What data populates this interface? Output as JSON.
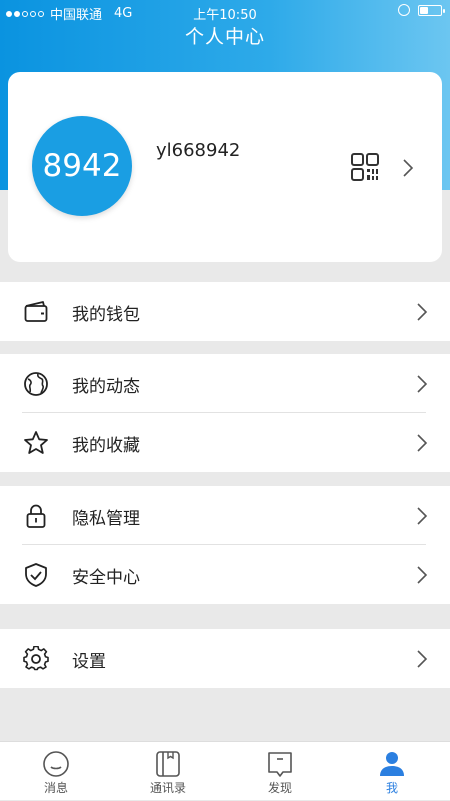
{
  "status_bar": {
    "carrier": "中国联通",
    "network": "4G",
    "time": "上午10:50"
  },
  "header": {
    "title": "个人中心"
  },
  "profile": {
    "avatar_text": "8942",
    "username": "yl668942",
    "avatar_color": "#1a9ee3"
  },
  "menu": {
    "wallet": "我的钱包",
    "moments": "我的动态",
    "favorites": "我的收藏",
    "privacy": "隐私管理",
    "security": "安全中心",
    "settings": "设置"
  },
  "tabs": [
    {
      "label": "消息",
      "icon": "message-icon"
    },
    {
      "label": "通讯录",
      "icon": "contacts-icon"
    },
    {
      "label": "发现",
      "icon": "discover-icon"
    },
    {
      "label": "我",
      "icon": "me-icon",
      "active": true
    }
  ],
  "colors": {
    "header_gradient_start": "#0a93e0",
    "header_gradient_end": "#6cc6f1",
    "active_tab": "#2b7fe0"
  }
}
